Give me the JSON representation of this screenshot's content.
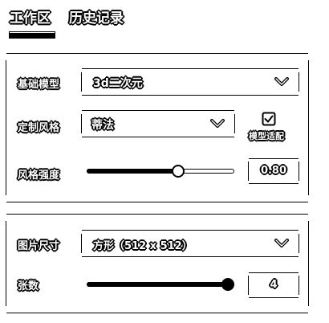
{
  "tabs": {
    "workspace": "工作区",
    "history": "历史记录"
  },
  "style_panel": {
    "base_model": {
      "label": "基础模型",
      "value": "3d二次元"
    },
    "custom_style": {
      "label": "定制风格",
      "value": "蒂法"
    },
    "model_adapt": {
      "label": "模型适配",
      "checked": true
    },
    "style_strength": {
      "label": "风格强度",
      "value": "0.80",
      "fraction": 0.62
    }
  },
  "image_panel": {
    "size": {
      "label": "图片尺寸",
      "value": "方形（512 x 512）"
    },
    "count": {
      "label": "张数",
      "value": "4",
      "fraction": 1.0
    }
  },
  "icons": {
    "dropdown": "chevron-down-icon",
    "checkbox": "checkbox-checked-icon"
  },
  "colors": {
    "ink": "#000000",
    "background": "#ffffff"
  }
}
